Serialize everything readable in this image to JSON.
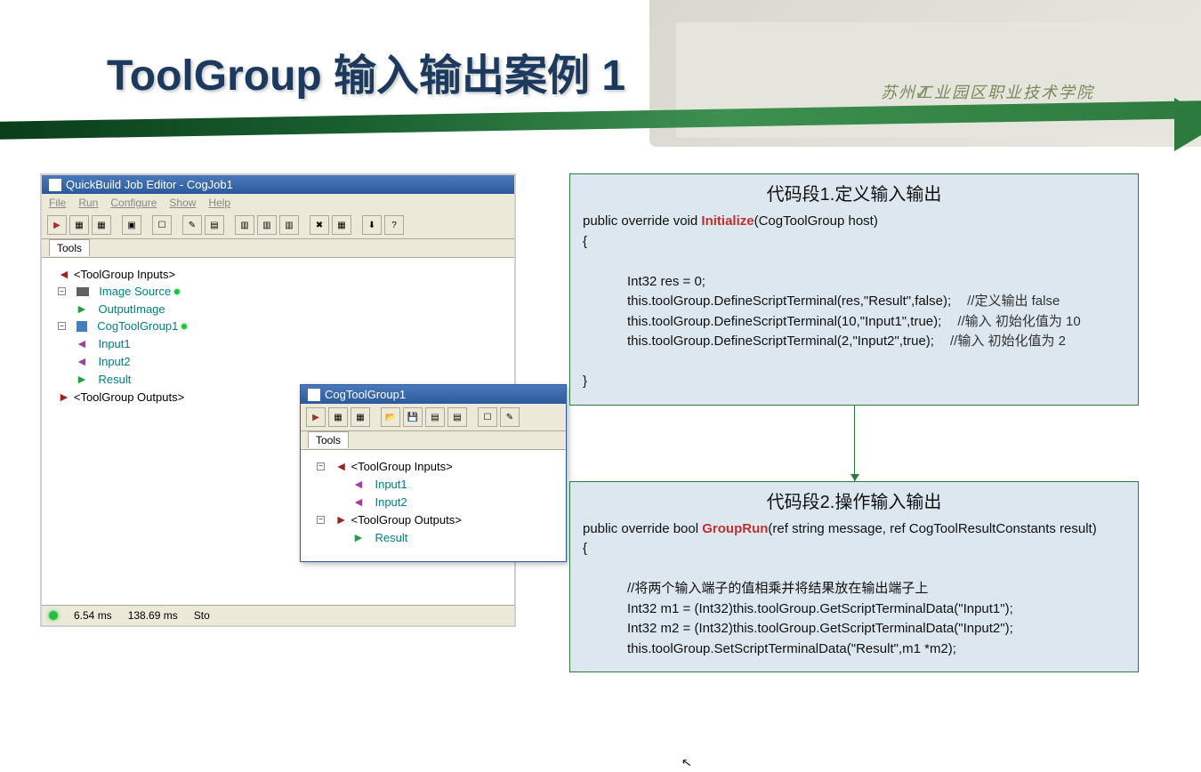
{
  "header": {
    "title": "ToolGroup 输入输出案例 1",
    "school": "苏州工业园区职业技术学院",
    "check": "✓"
  },
  "quickbuild": {
    "title": "QuickBuild Job Editor - CogJob1",
    "menu": {
      "file": "File",
      "run": "Run",
      "configure": "Configure",
      "show": "Show",
      "help": "Help"
    },
    "tools_tab": "Tools",
    "tree": {
      "inputs": "<ToolGroup Inputs>",
      "image_source": "Image Source",
      "output_image": "OutputImage",
      "cogtoolgroup": "CogToolGroup1",
      "input1": "Input1",
      "input2": "Input2",
      "result": "Result",
      "outputs": "<ToolGroup Outputs>"
    },
    "status": {
      "ms": "6.54 ms",
      "ms2": "138.69 ms",
      "stop": "Sto"
    }
  },
  "subwin": {
    "title": "CogToolGroup1",
    "tools_tab": "Tools",
    "tree": {
      "inputs": "<ToolGroup Inputs>",
      "input1": "Input1",
      "input2": "Input2",
      "outputs": "<ToolGroup Outputs>",
      "result": "Result"
    }
  },
  "code1": {
    "title": "代码段1.定义输入输出",
    "sig_a": "public override void ",
    "sig_b": "Initialize",
    "sig_c": "(CogToolGroup host)",
    "brace_open": "{",
    "l1": "Int32 res = 0;",
    "l2a": "this.toolGroup.DefineScriptTerminal(res,\"Result\",false);",
    "l2b": "//定义输出 false",
    "l3a": "this.toolGroup.DefineScriptTerminal(10,\"Input1\",true);",
    "l3b": "//输入 初始化值为 10",
    "l4a": "this.toolGroup.DefineScriptTerminal(2,\"Input2\",true);",
    "l4b": "//输入  初始化值为 2",
    "brace_close": "}"
  },
  "code2": {
    "title": "代码段2.操作输入输出",
    "sig_a": "public override bool ",
    "sig_b": "GroupRun",
    "sig_c": "(ref string message, ref CogToolResultConstants result)",
    "brace_open": "{",
    "c1": "//将两个输入端子的值相乘并将结果放在输出端子上",
    "l1": "Int32 m1 = (Int32)this.toolGroup.GetScriptTerminalData(\"Input1\");",
    "l2": "Int32 m2 = (Int32)this.toolGroup.GetScriptTerminalData(\"Input2\");",
    "l3": "this.toolGroup.SetScriptTerminalData(\"Result\",m1 *m2);"
  }
}
